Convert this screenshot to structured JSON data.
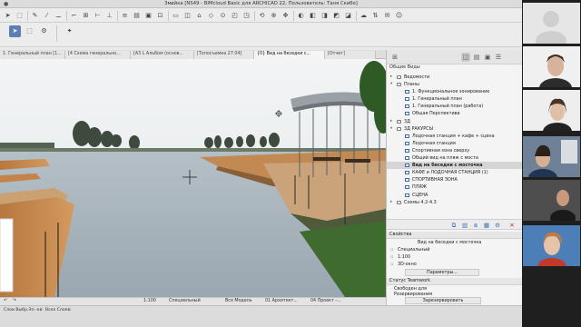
{
  "window": {
    "title": "Змейка [NS49 - BIMcloud Basic для ARCHICAD 22, Пользователь: Таня Скибо]"
  },
  "tabs": [
    {
      "label": "1. Генеральный план [1..."
    },
    {
      "label": "[4 Схема генерально..."
    },
    {
      "label": "[А3 L Альбом (основ..."
    },
    {
      "label": "[Топосъемка 27.04]"
    },
    {
      "label": "{0} Вид на беседки с..."
    },
    {
      "label": "[Отчет]"
    }
  ],
  "navigator": {
    "section_label": "Общие Виды",
    "items": [
      {
        "label": "Ведомости",
        "kind": "folder",
        "level": 1,
        "expanded": false
      },
      {
        "label": "Планы",
        "kind": "folder",
        "level": 1,
        "expanded": true
      },
      {
        "label": "1. Функциональное зонирование",
        "kind": "view",
        "level": 2
      },
      {
        "label": "1. Генеральный план",
        "kind": "view",
        "level": 2
      },
      {
        "label": "1. Генеральный план (работа)",
        "kind": "view",
        "level": 2
      },
      {
        "label": "Общая Перспектива",
        "kind": "view",
        "level": 2
      },
      {
        "label": "3Д",
        "kind": "folder",
        "level": 1,
        "expanded": false
      },
      {
        "label": "3Д РАКУРСЫ",
        "kind": "folder",
        "level": 1,
        "expanded": true
      },
      {
        "label": "Лодочная станция + кафе + сцена",
        "kind": "view",
        "level": 2
      },
      {
        "label": "Лодочная станция",
        "kind": "view",
        "level": 2
      },
      {
        "label": "Спортивная зона сверху",
        "kind": "view",
        "level": 2
      },
      {
        "label": "Общий вид на пляж с моста",
        "kind": "view",
        "level": 2
      },
      {
        "label": "Вид  на беседки с мосточка",
        "kind": "view",
        "level": 2,
        "selected": true
      },
      {
        "label": "КАФЕ и ЛОДОЧНАЯ СТАНЦИЯ (1)",
        "kind": "view",
        "level": 2
      },
      {
        "label": "СПОРТИВНАЯ ЗОНА",
        "kind": "view",
        "level": 2
      },
      {
        "label": "ПЛЯЖ",
        "kind": "view",
        "level": 2
      },
      {
        "label": "СЦЕНА",
        "kind": "view",
        "level": 2
      },
      {
        "label": "Схемы 4.2-4.3",
        "kind": "folder",
        "level": 1,
        "expanded": false
      }
    ]
  },
  "properties": {
    "header": "Свойства",
    "view_name": "Вид  на беседки с мосточка",
    "layer_combo": "Специальный",
    "scale": "1:100",
    "window_type": "3D-окно",
    "params_button": "Параметры..."
  },
  "teamwork": {
    "header": "Статус Teamwork",
    "status_line1": "Свободен для",
    "status_line2": "Резервирования",
    "reserve_button": "Зарезервировать"
  },
  "statusbar": {
    "scale": "1:100",
    "layer_combo": "Специальный",
    "model_view": "Вся Модель",
    "arch_option": "01 Архитект...",
    "project_option": "04 Проект -..."
  },
  "bottom": {
    "layer_label": "Слои Выбр.Эл.-ов:",
    "all_layers_label": "Всех Слоев:"
  },
  "colors": {
    "accent": "#5b7fb5",
    "water": "#a8b4bd",
    "deck": "#c8884c",
    "sky": "#eef1f3"
  },
  "icons": [
    "arrow-icon",
    "pencil-icon",
    "eyedropper-icon",
    "folder-icon",
    "view-icon",
    "gear-icon",
    "close-icon",
    "layout-icon",
    "publish-icon"
  ]
}
